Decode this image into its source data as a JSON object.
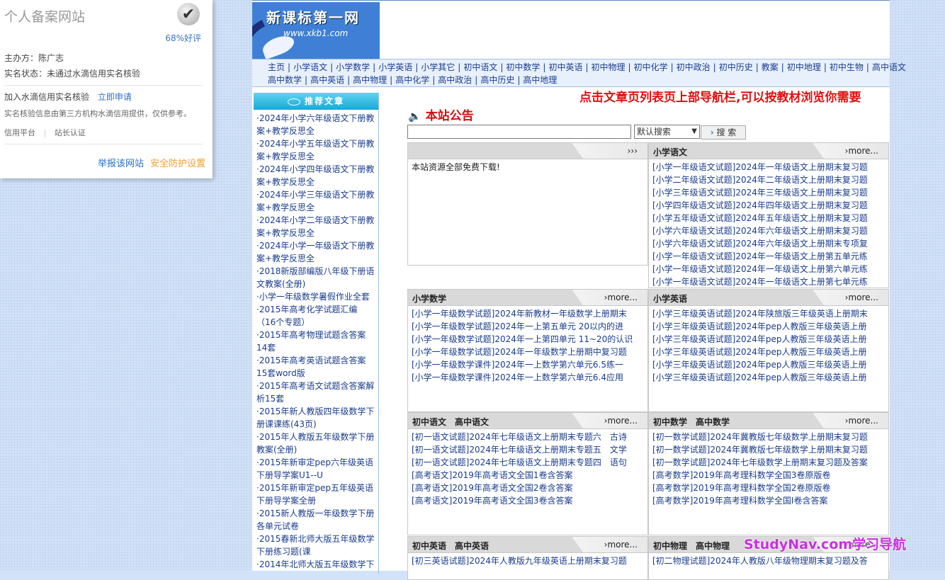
{
  "card": {
    "title": "个人备案网站",
    "rating": "68%好评",
    "sponsor": "主办方：陈广志",
    "verify_status": "实名状态：未通过水滴信用实名核验",
    "join": "加入水滴信用实名核验",
    "apply": "立即申请",
    "source_note": "实名核验信息由第三方机构水滴信用提供，仅供参考。",
    "link_platform": "信用平台",
    "link_owner": "站长认证",
    "report": "举报该网站",
    "security": "安全防护设置"
  },
  "logo": {
    "title": "新课标第一网",
    "url": "www.xkb1.com"
  },
  "nav": {
    "row1": [
      "主页",
      "小学语文",
      "小学数学",
      "小学英语",
      "小学其它",
      "初中语文",
      "初中数学",
      "初中英语",
      "初中物理",
      "初中化学",
      "初中政治",
      "初中历史",
      "教案",
      "初中地理",
      "初中生物",
      "高中语文"
    ],
    "row2": [
      "高中数学",
      "高中英语",
      "高中物理",
      "高中化学",
      "高中政治",
      "高中历史",
      "高中地理"
    ]
  },
  "recommend": {
    "title": "推荐文章",
    "items": [
      "·2024年小学六年级语文下册教案+教学反思全",
      "·2024年小学五年级语文下册教案+教学反思全",
      "·2024年小学四年级语文下册教案+教学反思全",
      "·2024年小学三年级语文下册教案+教学反思全",
      "·2024年小学二年级语文下册教案+教学反思全",
      "·2024年小学一年级语文下册教案+教学反思全",
      "·2018新版部编版八年级下册语文教案(全册)",
      "·小学一年级数学暑假作业全套",
      "·2015年高考化学试题汇编（16个专题）",
      "·2015年高考物理试题含答案14套",
      "·2015年高考英语试题含答案15套word版",
      "·2015年高考语文试题含答案解析15套",
      "·2015年新人教版四年级数学下册课课练(43页)",
      "·2015年人教版五年级数学下册教案(全册)",
      "·2015年新审定pep六年级英语下册导学案U1--U",
      "·2015年新审定pep五年级英语下册导学案全册",
      "·2015新人教版一年级数学下册各单元试卷",
      "·2015春新北师大版五年级数学下册练习题(课",
      "·2014年北师大版五年级数学下"
    ]
  },
  "notice_red": "点击文章页列表页上部导航栏,可以按教材浏览你需要",
  "announcement_title": "本站公告",
  "search": {
    "select": "默认搜索",
    "button": "搜 索"
  },
  "panels": [
    {
      "title": "",
      "more": "›››",
      "items": [
        "本站资源全部免费下载!"
      ]
    },
    {
      "title": "小学语文",
      "more": "›more...",
      "items": [
        "[小学一年级语文试题]2024年一年级语文上册期末复习题",
        "[小学二年级语文试题]2024年二年级语文上册期末复习题",
        "[小学三年级语文试题]2024年三年级语文上册期末复习题",
        "[小学四年级语文试题]2024年四年级语文上册期末复习题",
        "[小学五年级语文试题]2024年五年级语文上册期末复习题",
        "[小学六年级语文试题]2024年六年级语文上册期末复习题",
        "[小学六年级语文试题]2024年六年级语文上册期末专项复",
        "[小学一年级语文试题]2024年一年级语文上册第五单元练",
        "[小学一年级语文试题]2024年一年级语文上册第六单元练",
        "[小学一年级语文试题]2024年一年级语文上册第七单元练"
      ]
    },
    {
      "title": "小学数学",
      "more": "›more...",
      "items": [
        "[小学一年级数学试题]2024年新教材一年级数学上册期末",
        "[小学一年级数学试题]2024年一上第五单元 20以内的进",
        "[小学一年级数学试题]2024年一上第四单元 11~20的认识",
        "[小学一年级数学试题]2024年一年级数学上册期中复习题",
        "[小学一年级数学课件]2024年一上数学第六单元6.5练一",
        "[小学一年级数学课件]2024年一上数学第六单元6.4应用"
      ]
    },
    {
      "title": "小学英语",
      "more": "›more...",
      "items": [
        "[小学三年级英语试题]2024年陕旅版三年级英语上册期末",
        "[小学三年级英语试题]2024年pep人教版三年级英语上册",
        "[小学三年级英语试题]2024年pep人教版三年级英语上册",
        "[小学三年级英语试题]2024年pep人教版三年级英语上册",
        "[小学三年级英语试题]2024年pep人教版三年级英语上册",
        "[小学三年级英语试题]2024年pep人教版三年级英语上册"
      ]
    },
    {
      "title": "初中语文　高中语文",
      "more": "›more...",
      "items": [
        "[初一语文试题]2024年七年级语文上册期末专题六　古诗",
        "[初一语文试题]2024年七年级语文上册期末专题五　文学",
        "[初一语文试题]2024年七年级语文上册期末专题四　语句",
        "[高考语文]2019年高考语文全国1卷含答案",
        "[高考语文]2019年高考语文全国2卷含答案",
        "[高考语文]2019年高考语文全国3卷含答案"
      ]
    },
    {
      "title": "初中数学　高中数学",
      "more": "›more...",
      "items": [
        "[初一数学试题]2024年冀教版七年级数学上册期末复习题",
        "[初一数学试题]2024年冀教版七年级数学上册期末复习题",
        "[初一数学试题]2024年七年级数学上册期末复习题及答案",
        "[高考数学]2019年高考理科数学全国3卷原版卷",
        "[高考数学]2019年高考理科数学全国2卷原版卷",
        "[高考数学]2019年高考理科数学全国I卷含答案"
      ]
    },
    {
      "title": "初中英语　高中英语",
      "more": "›more...",
      "items": [
        "[初三英语试题]2024年人教版九年级英语上册期末复习题"
      ]
    },
    {
      "title": "初中物理　高中物理",
      "more": "›more...",
      "items": [
        "[初二物理试题]2024年人教版八年级物理期末复习题及答"
      ]
    }
  ],
  "watermark": "StudyNav.com学习导航"
}
